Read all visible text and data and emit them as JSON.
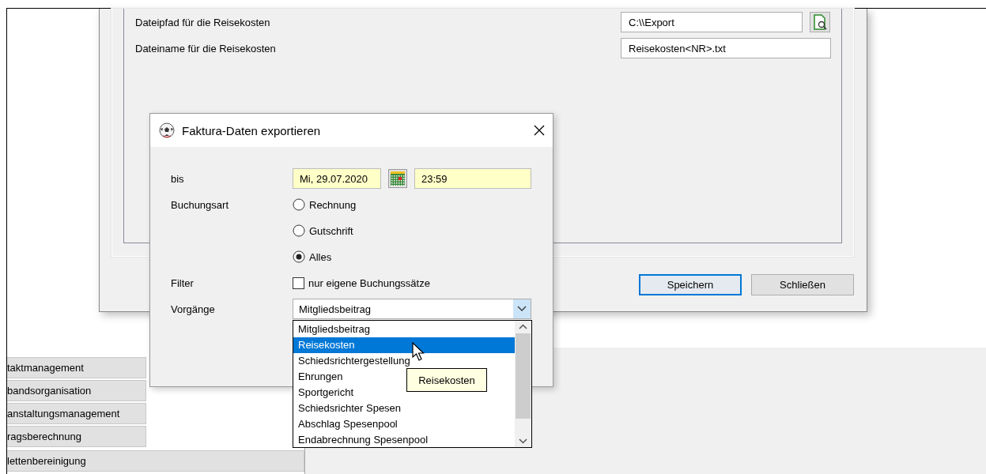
{
  "background": {
    "sidebar": {
      "items": [
        {
          "label": "taktmanagement"
        },
        {
          "label": "bandsorganisation"
        },
        {
          "label": "anstaltungsmanagement"
        },
        {
          "label": "ragsberechnung"
        },
        {
          "label": "lettenbereinigung"
        }
      ]
    }
  },
  "settings_window": {
    "fields": [
      {
        "label": "Dateipfad für die Reisekosten",
        "value": "C:\\\\Export",
        "kind": "browse"
      },
      {
        "label": "Dateiname für die Reisekosten",
        "value": "Reisekosten<NR>.txt",
        "kind": "text"
      }
    ],
    "buttons": [
      {
        "label": "Speichern",
        "default": true
      },
      {
        "label": "Schließen",
        "default": false
      }
    ]
  },
  "dialog": {
    "title": "Faktura-Daten exportieren",
    "until": {
      "label": "bis",
      "date": "Mi, 29.07.2020",
      "time": "23:59"
    },
    "booking_type": {
      "label": "Buchungsart",
      "options": [
        {
          "label": "Rechnung",
          "selected": false
        },
        {
          "label": "Gutschrift",
          "selected": false
        },
        {
          "label": "Alles",
          "selected": true
        }
      ]
    },
    "filter": {
      "label": "Filter",
      "checkbox": {
        "label": "nur eigene Buchungssätze",
        "checked": false
      }
    },
    "processes": {
      "label": "Vorgänge",
      "value": "Mitgliedsbeitrag",
      "list": [
        {
          "label": "Mitgliedsbeitrag",
          "highlighted": false
        },
        {
          "label": "Reisekosten",
          "highlighted": true
        },
        {
          "label": "Schiedsrichtergestellung",
          "highlighted": false
        },
        {
          "label": "Ehrungen",
          "highlighted": false
        },
        {
          "label": "Sportgericht",
          "highlighted": false
        },
        {
          "label": "Schiedsrichter Spesen",
          "highlighted": false
        },
        {
          "label": "Abschlag Spesenpool",
          "highlighted": false
        },
        {
          "label": "Endabrechnung Spesenpool",
          "highlighted": false
        }
      ],
      "tooltip": "Reisekosten"
    }
  }
}
